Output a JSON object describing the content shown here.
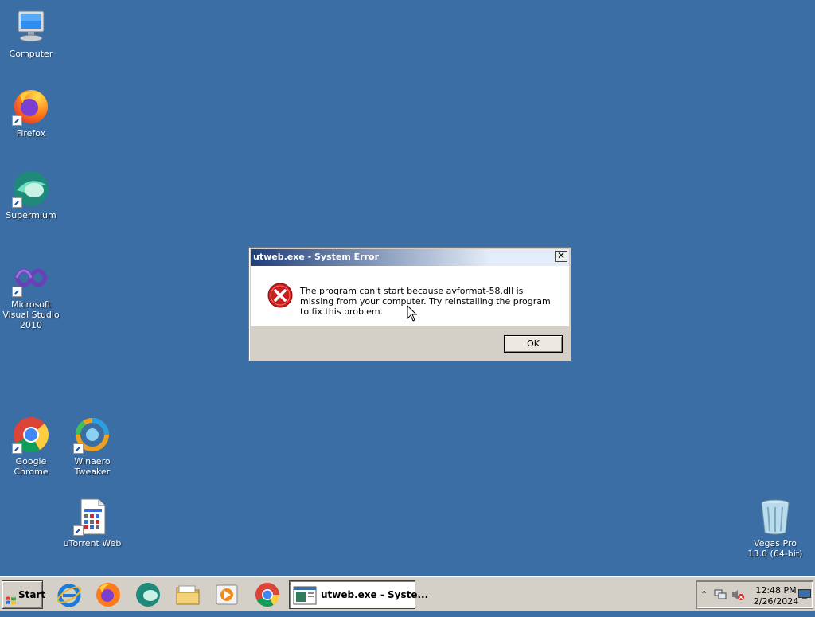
{
  "desktop": {
    "icons": [
      {
        "id": "computer",
        "label": "Computer",
        "icon": "computer-icon"
      },
      {
        "id": "firefox",
        "label": "Firefox",
        "icon": "firefox-icon"
      },
      {
        "id": "supermium",
        "label": "Supermium",
        "icon": "supermium-icon"
      },
      {
        "id": "msvs",
        "label": "Microsoft Visual Studio 2010",
        "icon": "visual-studio-icon"
      },
      {
        "id": "chrome",
        "label": "Google Chrome",
        "icon": "chrome-icon"
      },
      {
        "id": "winaero",
        "label": "Winaero Tweaker",
        "icon": "winaero-icon"
      },
      {
        "id": "utorrent",
        "label": "uTorrent Web",
        "icon": "utorrent-web-icon"
      },
      {
        "id": "vegas",
        "label": "Vegas Pro 13.0 (64-bit)",
        "icon": "recycle-bin-icon"
      }
    ],
    "background_color": "#3a6ea5"
  },
  "dialog": {
    "title": "utweb.exe - System Error",
    "close_glyph": "✕",
    "message": "The program can't start because avformat-58.dll is missing from your computer. Try reinstalling the program to fix this problem.",
    "ok_label": "OK",
    "icon": "error-icon"
  },
  "taskbar": {
    "start_label": "Start",
    "pinned": [
      "internet-explorer-icon",
      "firefox-icon",
      "supermium-icon",
      "file-explorer-icon",
      "media-player-icon",
      "chrome-icon"
    ],
    "active_task_label": "utweb.exe - Syste...",
    "tray": {
      "chevron": "⌃",
      "time": "12:48 PM",
      "date": "2/26/2024"
    }
  }
}
